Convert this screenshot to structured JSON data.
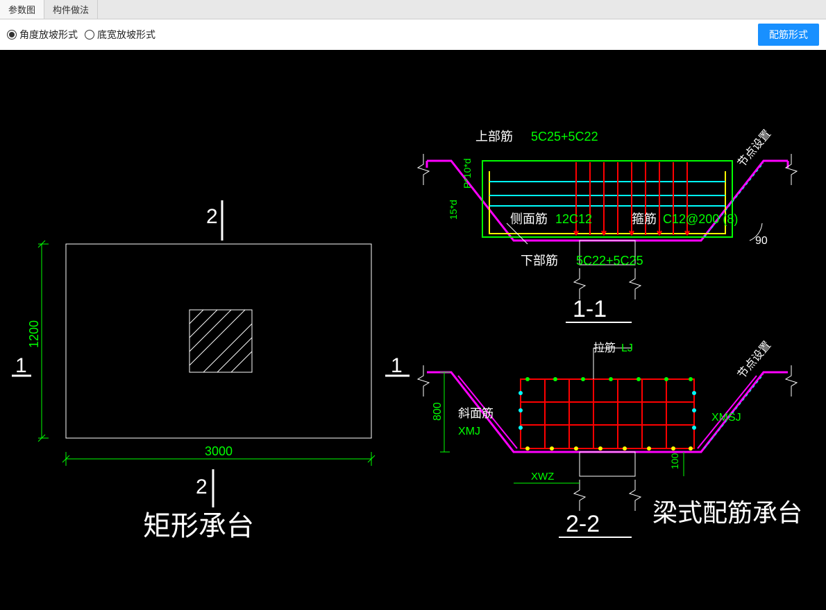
{
  "tabs": {
    "active": "参数图",
    "other": "构件做法"
  },
  "toolbar": {
    "radio_angle": "角度放坡形式",
    "radio_width": "底宽放坡形式",
    "button": "配筋形式"
  },
  "plan": {
    "width": "3000",
    "height": "1200",
    "mark_top": "2",
    "mark_bottom": "2",
    "mark_left": "1",
    "mark_right": "1",
    "title": "矩形承台"
  },
  "sec1": {
    "label": "1-1",
    "top_bar_lbl": "上部筋",
    "top_bar_val": "5C25+5C22",
    "side_bar_lbl": "侧面筋",
    "side_bar_val": "12C12",
    "stirrup_lbl": "箍筋",
    "stirrup_val": "C12@200 (8)",
    "bot_bar_lbl": "下部筋",
    "bot_bar_val": "5C22+5C25",
    "p10d": "P*10*d",
    "d15": "15*d",
    "angle": "90",
    "node": "节点设置"
  },
  "sec2": {
    "label": "2-2",
    "tie_lbl": "拉筋",
    "tie_val": "LJ",
    "slope_bar_lbl": "斜面筋",
    "xmj": "XMJ",
    "xmsj": "XMSJ",
    "xwz": "XWZ",
    "h800": "800",
    "h100": "100",
    "node": "节点设置",
    "title": "梁式配筋承台"
  }
}
